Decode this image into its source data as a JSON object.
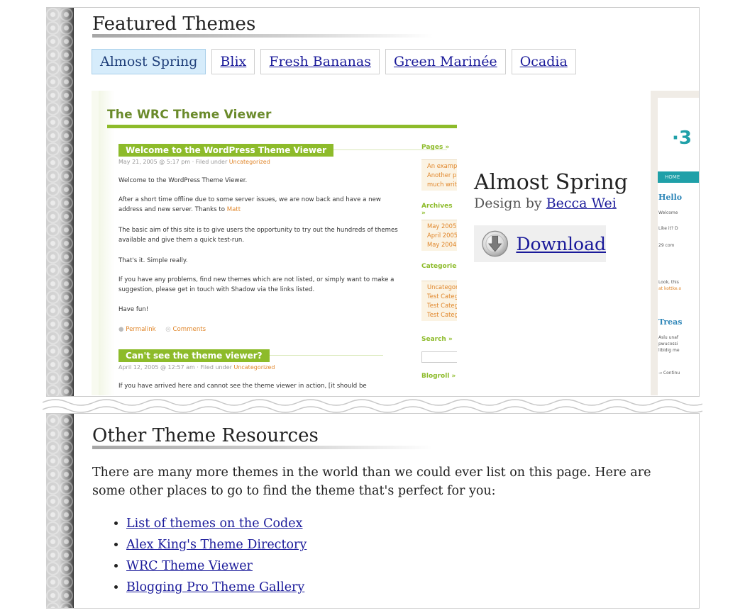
{
  "featured": {
    "heading": "Featured Themes",
    "tabs": [
      "Almost Spring",
      "Blix",
      "Fresh Bananas",
      "Green Marinée",
      "Ocadia"
    ],
    "active_tab": "Almost Spring",
    "theme_name": "Almost Spring",
    "design_by": "Design by",
    "designer": "Becca Wei",
    "download": "Download"
  },
  "preview": {
    "site_title": "The WRC Theme Viewer",
    "post1": {
      "title": "Welcome to the WordPress Theme Viewer",
      "meta_prefix": "May 21, 2005 @ 5:17 pm · Filed under",
      "meta_cat": "Uncategorized",
      "p1": "Welcome to the WordPress Theme Viewer.",
      "p2": "After a short time offline due to some server issues, we are now back and have a new address and new server. Thanks to",
      "p2_link": "Matt",
      "p3": "The basic aim of this site is to give users the opportunity to try out the hundreds of themes available and give them a quick test-run.",
      "p4": "That's it. Simple really.",
      "p5": "If you have any problems, find new themes which are not listed, or simply want to make a suggestion, please get in touch with Shadow via the links listed.",
      "p6": "Have fun!",
      "permalink": "Permalink",
      "comments": "Comments"
    },
    "post2": {
      "title": "Can't see the theme viewer?",
      "meta_prefix": "April 12, 2005 @ 12:57 am · Filed under",
      "meta_cat": "Uncategorized",
      "p1": "If you have arrived here and cannot see the theme viewer in action, [it should be"
    },
    "sidebar": {
      "pages_h": "Pages »",
      "pages": [
        "An example",
        "Another pag",
        "much writin"
      ],
      "archives_h": "Archives »",
      "archives": [
        "May 2005",
        "April 2005",
        "May 2004"
      ],
      "categories_h": "Categories",
      "categories": [
        "Uncategoriz",
        "Test Catego",
        "Test Catego",
        "Test Catego"
      ],
      "search_h": "Search »",
      "blogroll_h": "Blogroll »"
    },
    "second": {
      "logo": "·3",
      "nav": "HOME",
      "h1": "Hello",
      "t1": "Welcome",
      "t2": "Like it? D",
      "t3": "29 com",
      "t4a": "Look, this",
      "t4b": "at",
      "t4b_link": "kottke.o",
      "h2": "Treas",
      "t5a": "Aslu unaf",
      "t5b": "pwucossi",
      "t5c": "libidig me",
      "t6": "→ Continu"
    }
  },
  "resources": {
    "heading": "Other Theme Resources",
    "intro": "There are many more themes in the world than we could ever list on this page. Here are some other places to go to find the theme that's perfect for you:",
    "links": [
      "List of themes on the Codex",
      "Alex King's Theme Directory",
      "WRC Theme Viewer",
      "Blogging Pro Theme Gallery"
    ]
  }
}
